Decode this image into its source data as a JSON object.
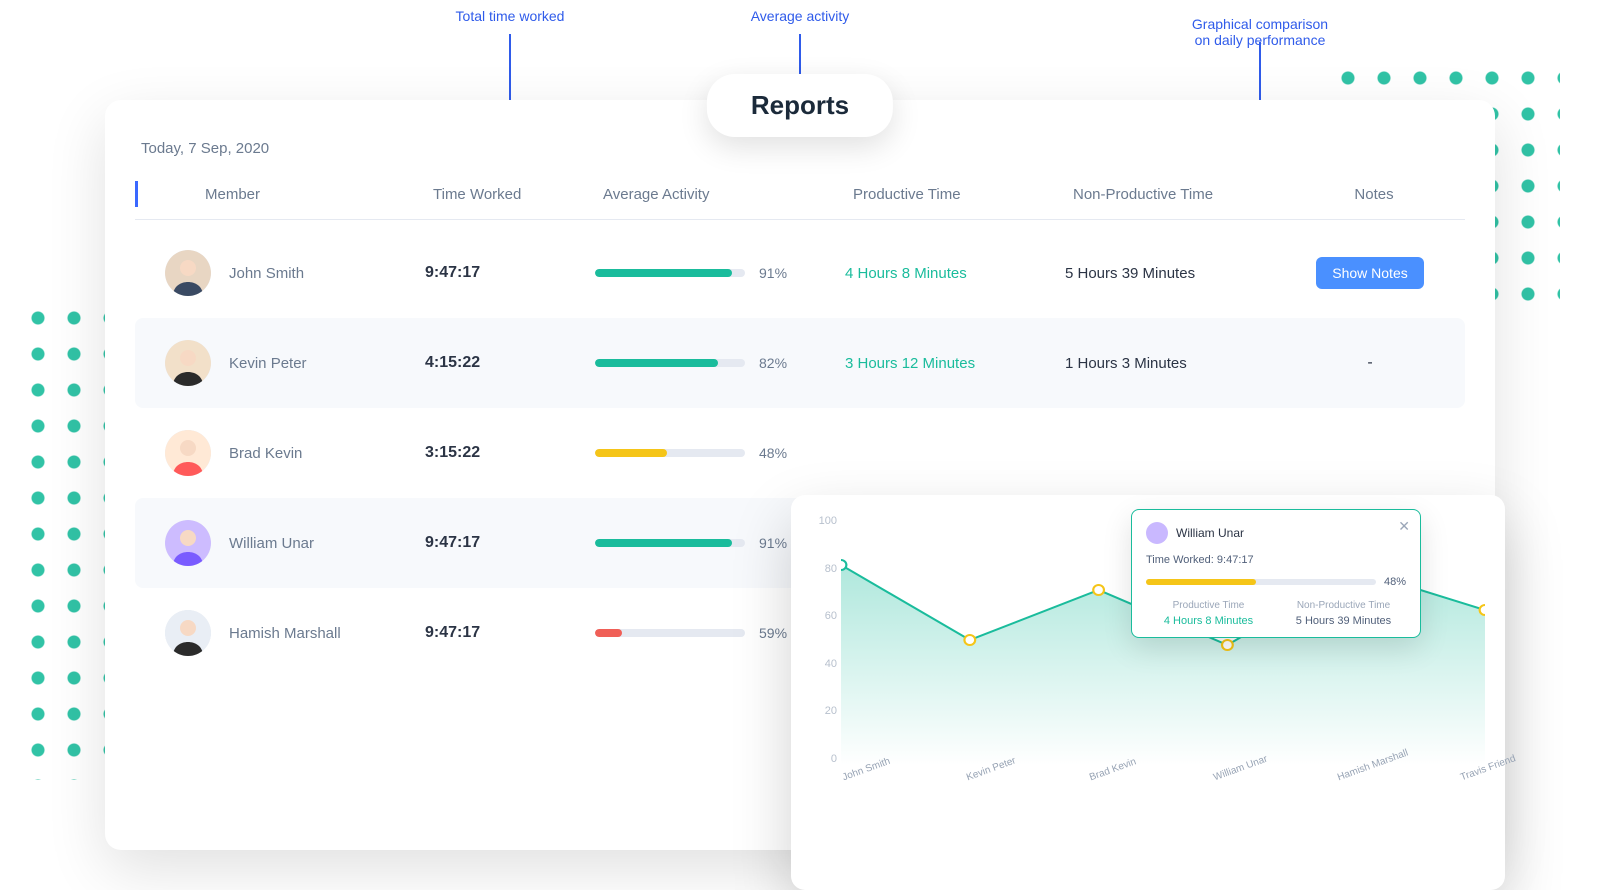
{
  "annotations": {
    "time_worked": "Total time worked",
    "avg_activity": "Average activity",
    "chart": "Graphical comparison\non daily performance"
  },
  "header": {
    "title": "Reports",
    "date": "Today, 7 Sep, 2020"
  },
  "columns": {
    "member": "Member",
    "time_worked": "Time Worked",
    "avg_activity": "Average Activity",
    "productive": "Productive Time",
    "non_productive": "Non-Productive Time",
    "notes": "Notes"
  },
  "buttons": {
    "show_notes": "Show Notes"
  },
  "colors": {
    "teal": "#1abc9c",
    "yellow": "#f5c518",
    "red": "#f05f57",
    "blue": "#4a90ff"
  },
  "rows": [
    {
      "name": "John Smith",
      "time": "9:47:17",
      "activity_pct": 91,
      "activity_color": "teal",
      "productive": "4 Hours 8 Minutes",
      "non_productive": "5 Hours 39 Minutes",
      "notes": "button"
    },
    {
      "name": "Kevin Peter",
      "time": "4:15:22",
      "activity_pct": 82,
      "activity_color": "teal",
      "productive": "3 Hours 12 Minutes",
      "non_productive": "1 Hours 3 Minutes",
      "notes": "-"
    },
    {
      "name": "Brad Kevin",
      "time": "3:15:22",
      "activity_pct": 48,
      "activity_color": "yellow",
      "productive": "",
      "non_productive": "",
      "notes": ""
    },
    {
      "name": "William Unar",
      "time": "9:47:17",
      "activity_pct": 91,
      "activity_color": "teal",
      "productive": "",
      "non_productive": "",
      "notes": ""
    },
    {
      "name": "Hamish Marshall",
      "time": "9:47:17",
      "activity_pct": 59,
      "activity_color": "red",
      "productive": "",
      "non_productive": "",
      "notes": ""
    }
  ],
  "tooltip": {
    "name": "William Unar",
    "time_worked_label": "Time Worked:",
    "time_worked_value": "9:47:17",
    "activity_pct": 48,
    "productive_label": "Productive Time",
    "productive_value": "4 Hours 8 Minutes",
    "non_productive_label": "Non-Productive Time",
    "non_productive_value": "5 Hours 39 Minutes"
  },
  "chart_data": {
    "type": "area",
    "title": "",
    "xlabel": "",
    "ylabel": "",
    "ylim": [
      0,
      100
    ],
    "y_ticks": [
      100,
      80,
      60,
      40,
      20,
      0
    ],
    "categories": [
      "John Smith",
      "Kevin Peter",
      "Brad Kevin",
      "William Unar",
      "Hamish Marshall",
      "Travis Friend"
    ],
    "values": [
      80,
      50,
      70,
      48,
      78,
      62
    ],
    "highlight_index": 3
  }
}
